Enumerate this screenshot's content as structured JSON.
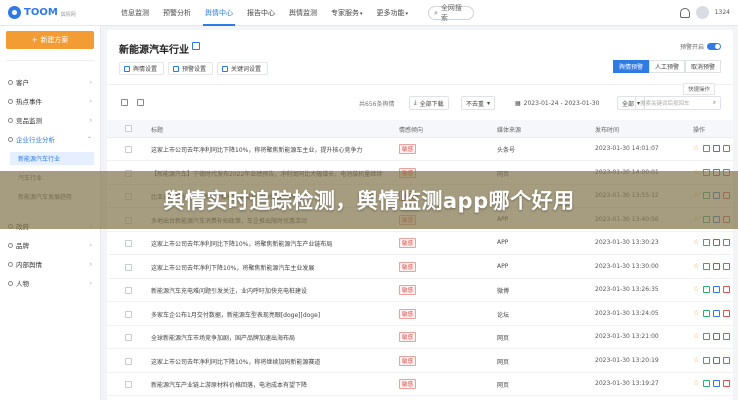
{
  "brand": {
    "name": "TOOM",
    "sub": "舆情网"
  },
  "nav": [
    {
      "label": "信息监测",
      "active": false,
      "caret": false
    },
    {
      "label": "预警分析",
      "active": false,
      "caret": false
    },
    {
      "label": "舆情中心",
      "active": true,
      "caret": false
    },
    {
      "label": "报告中心",
      "active": false,
      "caret": false
    },
    {
      "label": "舆情监测",
      "active": false,
      "caret": false
    },
    {
      "label": "专家服务",
      "active": false,
      "caret": true
    },
    {
      "label": "更多功能",
      "active": false,
      "caret": true
    }
  ],
  "top_search": "全网搜索",
  "user_num": "1324",
  "sidebar": {
    "new_button": "新建方案",
    "items": [
      {
        "label": "客户",
        "active": false
      },
      {
        "label": "热点事件",
        "active": false
      },
      {
        "label": "竞品监测",
        "active": false
      },
      {
        "label": "企业行业分析",
        "active": true
      }
    ],
    "sub_items": [
      {
        "label": "新能源汽车行业",
        "selected": true
      },
      {
        "label": "汽车行业",
        "selected": false
      },
      {
        "label": "新能源汽车发展趋势",
        "selected": false
      }
    ],
    "items_after": [
      {
        "label": "政府"
      },
      {
        "label": "品牌"
      },
      {
        "label": "内部舆情"
      },
      {
        "label": "人物"
      }
    ]
  },
  "main": {
    "title": "新能源汽车行业",
    "pills": [
      "舆情设置",
      "预警设置",
      "关键词设置"
    ],
    "toggle_label": "预警开启",
    "seg": [
      "舆情预警",
      "人工预警",
      "取消预警"
    ],
    "toolbar": {
      "count": "共656条舆情",
      "export": "全部下载",
      "filter": "不去重",
      "date": "2023-01-24 - 2023-01-30",
      "sort": "全部",
      "search_placeholder": "搜索关键词后按回车"
    },
    "tooltip": "快捷操作",
    "headers": [
      "标题",
      "情感倾向",
      "媒体来源",
      "发布时间",
      "操作"
    ]
  },
  "rows": [
    {
      "title": "这家上市公司去年净利同比下降10%，称将聚焦新能源车主业，提升核心竞争力",
      "emotion": "敏感",
      "source": "头条号",
      "time": "2023-01-30 14:01:07"
    },
    {
      "title": "【新能源汽车】宁德时代发布2022年业绩预告，净利润同比大幅增长，电池装机量继续领跑",
      "emotion": "敏感",
      "source": "网页",
      "time": "2023-01-30 14:00:01"
    },
    {
      "title": "比亚迪1月销量再创新高，新能源乘用车市场份额持续提升",
      "emotion": "敏感",
      "source": "网页",
      "time": "2023-01-30 13:55:12"
    },
    {
      "title": "多地出台新能源汽车消费补贴政策，车企推出限时优惠活动",
      "emotion": "敏感",
      "source": "APP",
      "time": "2023-01-30 13:40:56"
    },
    {
      "title": "这家上市公司去年净利同比下降10%，将聚焦新能源汽车产业链布局",
      "emotion": "敏感",
      "source": "APP",
      "time": "2023-01-30 13:30:23"
    },
    {
      "title": "这家上市公司去年净利下降10%，将聚焦新能源汽车主业发展",
      "emotion": "敏感",
      "source": "APP",
      "time": "2023-01-30 13:30:00"
    },
    {
      "title": "新能源汽车充电难问题引发关注，业内呼吁加快充电桩建设",
      "emotion": "敏感",
      "source": "微博",
      "time": "2023-01-30 13:26:35"
    },
    {
      "title": "多家车企公布1月交付数据，新能源车型表现亮眼[doge][doge]",
      "emotion": "敏感",
      "source": "论坛",
      "time": "2023-01-30 13:24:05"
    },
    {
      "title": "全球新能源汽车市场竞争加剧，国产品牌加速出海布局",
      "emotion": "敏感",
      "source": "网页",
      "time": "2023-01-30 13:21:00"
    },
    {
      "title": "这家上市公司去年净利同比下降10%，称将继续加码新能源赛道",
      "emotion": "敏感",
      "source": "网页",
      "time": "2023-01-30 13:20:19"
    },
    {
      "title": "新能源汽车产业链上游原材料价格回落，电池成本有望下降",
      "emotion": "敏感",
      "source": "网页",
      "time": "2023-01-30 13:19:27"
    }
  ],
  "banner": "舆情实时追踪检测，舆情监测app哪个好用"
}
